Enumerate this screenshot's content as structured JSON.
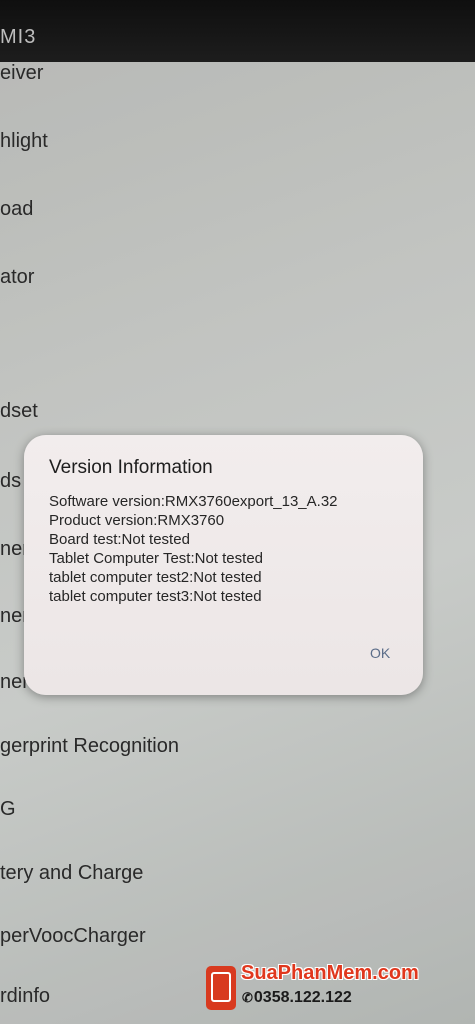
{
  "app": {
    "title": "MI3"
  },
  "list": {
    "items": [
      "eiver",
      "hlight",
      "oad",
      "ator",
      "dset",
      "ds",
      "ner",
      "ner",
      "ner",
      "gerprint Recognition",
      "G",
      "tery and Charge",
      "perVoocCharger",
      "rdinfo"
    ]
  },
  "dialog": {
    "title": "Version Information",
    "lines": [
      "Software version:RMX3760export_13_A.32",
      "Product version:RMX3760",
      "Board test:Not tested",
      "Tablet Computer Test:Not tested",
      "tablet computer test2:Not tested",
      "tablet computer test3:Not tested"
    ],
    "ok_label": "OK"
  },
  "watermark": {
    "site": "SuaPhanMem.com",
    "phone_icon": "phone-icon",
    "phone": "0358.122.122"
  },
  "colors": {
    "dialog_bg": "#efe9e9",
    "ok_text": "#5b6d89",
    "watermark_red": "#e0371d",
    "status_bar": "#141414"
  }
}
